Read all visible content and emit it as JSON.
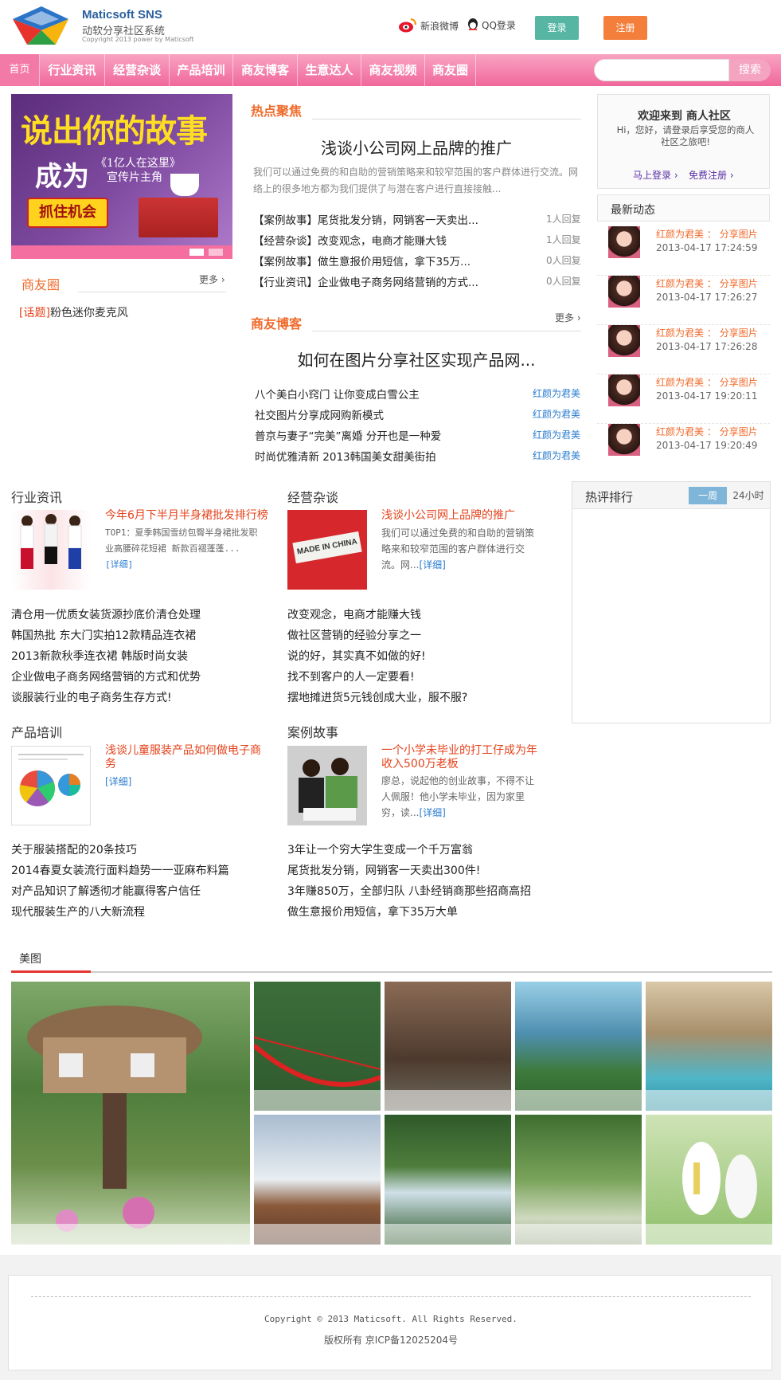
{
  "brand": {
    "name": "Maticsoft SNS",
    "subtitle": "动软分享社区系统",
    "copyright": "Copyright 2013 power by Maticsoft"
  },
  "auth": {
    "weibo": "新浪微博",
    "qq": "QQ登录",
    "login": "登录",
    "register": "注册"
  },
  "nav": {
    "items": [
      "首页",
      "行业资讯",
      "经营杂谈",
      "产品培训",
      "商友博客",
      "生意达人",
      "商友视频",
      "商友圈"
    ],
    "search_button": "搜索",
    "search_placeholder": ""
  },
  "banner": {
    "line1": "说出你的故事",
    "line2": "成为",
    "line3a": "《1亿人在这里》",
    "line3b": "宣传片主角",
    "cta": "抓住机会"
  },
  "friends_circle": {
    "title": "商友圈",
    "more": "更多",
    "tag": "[话题]",
    "item": "粉色迷你麦克风"
  },
  "hot_focus": {
    "title": "热点聚焦",
    "headline": "浅谈小公司网上品牌的推广",
    "desc": "我们可以通过免费的和自助的营销策略来和较窄范围的客户群体进行交流。网络上的很多地方都为我们提供了与潜在客户进行直接接触...",
    "items": [
      {
        "text": "【案例故事】尾货批发分销，网销客一天卖出...",
        "count": "1人回复"
      },
      {
        "text": "【经营杂谈】改变观念，电商才能赚大钱",
        "count": "1人回复"
      },
      {
        "text": "【案例故事】做生意报价用短信，拿下35万...",
        "count": "0人回复"
      },
      {
        "text": "【行业资讯】企业做电子商务网络营销的方式...",
        "count": "0人回复"
      }
    ]
  },
  "blog": {
    "title": "商友博客",
    "more": "更多",
    "headline": "如何在图片分享社区实现产品网...",
    "items": [
      {
        "text": "八个美白小窍门 让你变成白雪公主",
        "author": "红颜为君美"
      },
      {
        "text": "社交图片分享成网购新模式",
        "author": "红颜为君美"
      },
      {
        "text": "普京与妻子“完美”离婚 分开也是一种爱",
        "author": "红颜为君美"
      },
      {
        "text": "时尚优雅清新 2013韩国美女甜美街拍",
        "author": "红颜为君美"
      }
    ]
  },
  "welcome": {
    "title": "欢迎来到 商人社区",
    "text": "Hi，您好，请登录后享受您的商人社区之旅吧!",
    "login": "马上登录",
    "register": "免费注册"
  },
  "feed": {
    "title": "最新动态",
    "items": [
      {
        "name": "红颜为君美",
        "sep": "：",
        "action": "分享图片",
        "time": "2013-04-17 17:24:59"
      },
      {
        "name": "红颜为君美",
        "sep": "：",
        "action": "分享图片",
        "time": "2013-04-17 17:26:27"
      },
      {
        "name": "红颜为君美",
        "sep": "：",
        "action": "分享图片",
        "time": "2013-04-17 17:26:28"
      },
      {
        "name": "红颜为君美",
        "sep": "：",
        "action": "分享图片",
        "time": "2013-04-17 19:20:11"
      },
      {
        "name": "红颜为君美",
        "sep": "：",
        "action": "分享图片",
        "time": "2013-04-17 19:20:49"
      }
    ]
  },
  "industry": {
    "title": "行业资讯",
    "feature_title": "今年6月下半月半身裙批发排行榜",
    "feature_desc": "TOP1：夏季韩国雪纺包臀半身裙批发职业高腰碎花短裙 新款百褶蓬蓬...",
    "detail": "[详细]",
    "items": [
      "清仓用一优质女装货源抄底价清仓处理",
      "韩国热批 东大门实拍12款精品连衣裙",
      "2013新款秋季连衣裙 韩版时尚女装",
      "企业做电子商务网络营销的方式和优势",
      "谈服装行业的电子商务生存方式!"
    ]
  },
  "business": {
    "title": "经营杂谈",
    "feature_title": "浅谈小公司网上品牌的推广",
    "feature_desc": "我们可以通过免费的和自助的营销策略来和较窄范围的客户群体进行交流。网...",
    "detail": "[详细]",
    "thumb_text": "MADE IN CHINA",
    "items": [
      "改变观念，电商才能赚大钱",
      "做社区营销的经验分享之一",
      "说的好，其实真不如做的好!",
      "找不到客户的人一定要看!",
      "摆地摊进货5元钱创成大业，服不服?"
    ]
  },
  "training": {
    "title": "产品培训",
    "feature_title": "浅谈儿童服装产品如何做电子商务",
    "detail": "[详细]",
    "items": [
      "关于服装搭配的20条技巧",
      "2014春夏女装流行面料趋势一一亚麻布料篇",
      "对产品知识了解透彻才能赢得客户信任",
      "现代服装生产的八大新流程"
    ]
  },
  "cases": {
    "title": "案例故事",
    "feature_title": "一个小学未毕业的打工仔成为年收入500万老板",
    "feature_desc": "廖总，说起他的创业故事，不得不让人佩服！他小学未毕业，因为家里穷，读...",
    "detail": "[详细]",
    "items": [
      "3年让一个穷大学生变成一个千万富翁",
      "尾货批发分销，网销客一天卖出300件!",
      "3年赚850万，全部归队 八卦经销商那些招商高招",
      "做生意报价用短信，拿下35万大单"
    ]
  },
  "ranking": {
    "title": "热评排行",
    "tab_week": "一周",
    "tab_day": "24小时"
  },
  "gallery": {
    "title": "美图"
  },
  "footer": {
    "copyright": "Copyright © 2013 Maticsoft. All Rights Reserved.",
    "icp": "版权所有 京ICP备12025204号"
  }
}
